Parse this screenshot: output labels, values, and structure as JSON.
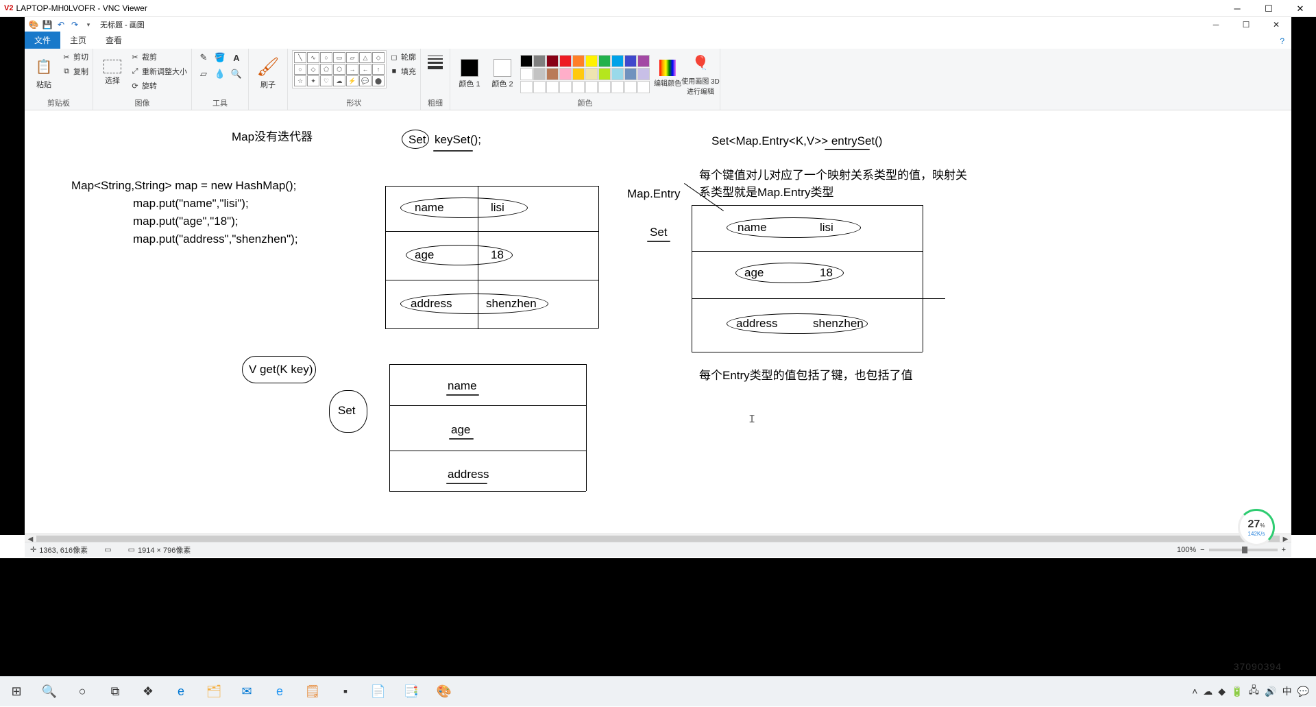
{
  "vnc": {
    "title": "LAPTOP-MH0LVOFR - VNC Viewer",
    "logo": "V2"
  },
  "paint": {
    "title": "无标题 - 画图",
    "tabs": {
      "file": "文件",
      "home": "主页",
      "view": "查看"
    },
    "groups": {
      "clipboard": {
        "label": "剪贴板",
        "paste": "粘贴",
        "cut": "剪切",
        "copy": "复制"
      },
      "image": {
        "label": "图像",
        "select": "选择",
        "crop": "裁剪",
        "resize": "重新调整大小",
        "rotate": "旋转"
      },
      "tools": {
        "label": "工具"
      },
      "brush": {
        "label": "刷子"
      },
      "shapes": {
        "label": "形状",
        "outline": "轮廓",
        "fill": "填充"
      },
      "size": {
        "label": "粗细"
      },
      "colors": {
        "label": "颜色",
        "c1": "颜色 1",
        "c2": "颜色 2",
        "edit": "编辑颜色",
        "paint3d": "使用画图 3D 进行编辑"
      }
    },
    "palette": [
      "#000000",
      "#7f7f7f",
      "#880015",
      "#ed1c24",
      "#ff7f27",
      "#fff200",
      "#22b14c",
      "#00a2e8",
      "#3f48cc",
      "#a349a4",
      "#ffffff",
      "#c3c3c3",
      "#b97a57",
      "#ffaec9",
      "#ffc90e",
      "#efe4b0",
      "#b5e61d",
      "#99d9ea",
      "#7092be",
      "#c8bfe7"
    ]
  },
  "canvas": {
    "note": "Map没有迭代器",
    "code1": "Map<String,String> map = new HashMap();",
    "code2": "map.put(\"name\",\"lisi\");",
    "code3": "map.put(\"age\",\"18\");",
    "code4": "map.put(\"address\",\"shenzhen\");",
    "set_lbl": "Set",
    "keyset": "keySet();",
    "entryset_sig": "Set<Map.Entry<K,V>>  entrySet()",
    "entry_lbl": "Map.Entry",
    "set_lbl2": "Set",
    "desc1": "每个键值对儿对应了一个映射关系类型的值，映射关系类型就是Map.Entry类型",
    "desc2": "每个Entry类型的值包括了键，也包括了值",
    "vget": "V get(K key)",
    "set_lbl3": "Set",
    "t1": {
      "r1k": "name",
      "r1v": "lisi",
      "r2k": "age",
      "r2v": "18",
      "r3k": "address",
      "r3v": "shenzhen"
    },
    "t2": {
      "r1": "name",
      "r2": "age",
      "r3": "address"
    },
    "t3": {
      "r1k": "name",
      "r1v": "lisi",
      "r2k": "age",
      "r2v": "18",
      "r3k": "address",
      "r3v": "shenzhen"
    }
  },
  "status": {
    "coords": "1363, 616像素",
    "canvas_size": "1914 × 796像素",
    "zoom": "100%"
  },
  "speed": {
    "pct": "27",
    "unit": "%",
    "rate": "142K/s"
  },
  "watermark": "37090394"
}
